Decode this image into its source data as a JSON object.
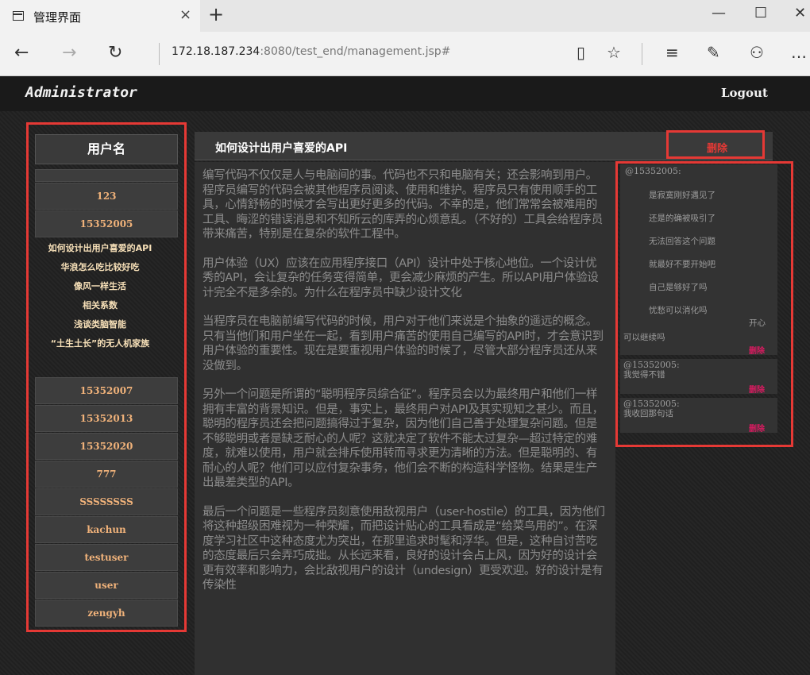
{
  "browser": {
    "tab_title": "管理界面",
    "tab_close": "×",
    "new_tab": "+",
    "url_host": "172.18.187.234",
    "url_rest": ":8080/test_end/management.jsp#",
    "icons": [
      "back-icon",
      "forward-icon",
      "refresh-icon",
      "reading-view-icon",
      "favorite-star-icon",
      "hub-icon",
      "web-note-icon",
      "share-icon",
      "more-icon"
    ]
  },
  "header": {
    "title": "Administrator",
    "logout_label": "Logout"
  },
  "sidebar": {
    "header": "用户名",
    "users_top": [
      "",
      "123",
      "15352005"
    ],
    "articles": [
      "如何设计出用户喜爱的API",
      "华浪怎么吃比较好吃",
      "像风一样生活",
      "相关系数",
      "浅谈类脑智能",
      "“土生土长”的无人机家族"
    ],
    "users_bottom": [
      "15352007",
      "15352013",
      "15352020",
      "777",
      "SSSSSSSS",
      "kachun",
      "testuser",
      "user",
      "zengyh"
    ]
  },
  "article": {
    "title": "如何设计出用户喜爱的API",
    "delete_label": "删除",
    "paragraphs": [
      "编写代码不仅仅是人与电脑间的事。代码也不只和电脑有关；还会影响到用户。程序员编写的代码会被其他程序员阅读、使用和维护。程序员只有使用顺手的工具，心情舒畅的时候才会写出更好更多的代码。不幸的是，他们常常会被难用的工具、晦涩的错误消息和不知所云的库弄的心烦意乱。（不好的）工具会给程序员带来痛苦，特别是在复杂的软件工程中。",
      "用户体验（UX）应该在应用程序接口（API）设计中处于核心地位。一个设计优秀的API，会让复杂的任务变得简单，更会减少麻烦的产生。所以API用户体验设计完全不是多余的。为什么在程序员中缺少设计文化",
      "当程序员在电脑前编写代码的时候，用户对于他们来说是个抽象的遥远的概念。只有当他们和用户坐在一起，看到用户痛苦的使用自己编写的API时，才会意识到用户体验的重要性。现在是要重视用户体验的时候了，尽管大部分程序员还从来没做到。",
      "另外一个问题是所谓的“聪明程序员综合征”。程序员会以为最终用户和他们一样拥有丰富的背景知识。但是，事实上，最终用户对API及其实现知之甚少。而且，聪明的程序员还会把问题搞得过于复杂，因为他们自己善于处理复杂问题。但是不够聪明或者是缺乏耐心的人呢？这就决定了软件不能太过复杂—超过特定的难度，就难以使用，用户就会排斥使用转而寻求更为清晰的方法。但是聪明的、有耐心的人呢？他们可以应付复杂事务，他们会不断的构造科学怪物。结果是生产出最差类型的API。",
      "最后一个问题是一些程序员刻意使用敌视用户（user-hostile）的工具，因为他们将这种超级困难视为一种荣耀，而把设计贴心的工具看成是“给菜鸟用的”。在深度学习社区中这种态度尤为突出，在那里追求时髦和浮华。但是，这种自讨苦吃的态度最后只会弄巧成拙。从长远来看，良好的设计会占上风，因为好的设计会更有效率和影响力，会比敌视用户的设计（undesign）更受欢迎。好的设计是有传染性"
    ]
  },
  "comments": {
    "main": {
      "user": "@15352005:",
      "lines": [
        "是寂寞刚好遇见了",
        "还是的确被吸引了",
        "无法回答这个问题",
        "就最好不要开始吧",
        "自己是够好了吗",
        "忧愁可以消化吗",
        "开心",
        "可以继续吗"
      ],
      "delete_label": "删除"
    },
    "replies": [
      {
        "user": "@15352005:",
        "text": "我觉得不错",
        "delete_label": "删除"
      },
      {
        "user": "@15352005:",
        "text": "我收回那句话",
        "delete_label": "删除"
      }
    ]
  }
}
